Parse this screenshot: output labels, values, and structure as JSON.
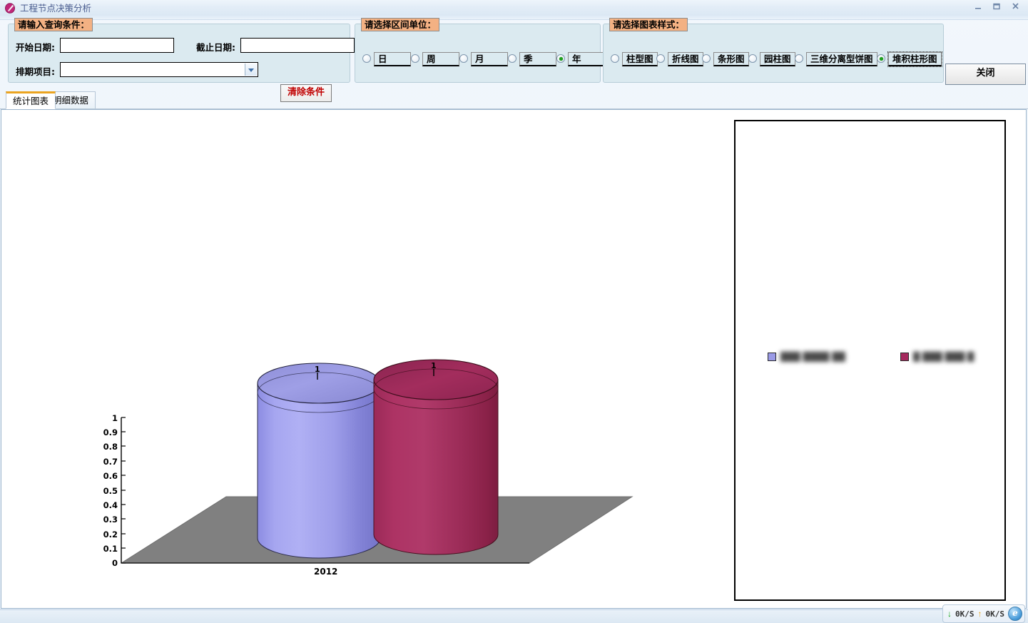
{
  "window": {
    "title": "工程节点决策分析",
    "icon": "access-database-icon",
    "minimize_label": "–",
    "maximize_label": "❐",
    "close_label": "✕"
  },
  "query_group": {
    "legend": "请输入查询条件：",
    "start_date": {
      "label": "开始日期:",
      "value": "",
      "placeholder": ""
    },
    "end_date": {
      "label": "截止日期:",
      "value": "",
      "placeholder": ""
    },
    "project": {
      "label": "排期项目:",
      "value": "",
      "placeholder": "",
      "options": []
    },
    "clear_button": "清除条件"
  },
  "unit_group": {
    "legend": "请选择区间单位：",
    "options": [
      {
        "label": "日",
        "selected": false
      },
      {
        "label": "周",
        "selected": false
      },
      {
        "label": "月",
        "selected": false
      },
      {
        "label": "季",
        "selected": false
      },
      {
        "label": "年",
        "selected": true
      }
    ],
    "selected_value": "年"
  },
  "style_group": {
    "legend": "请选择图表样式：",
    "options": [
      {
        "label": "柱型图",
        "selected": false
      },
      {
        "label": "折线图",
        "selected": false
      },
      {
        "label": "条形图",
        "selected": false
      },
      {
        "label": "园柱图",
        "selected": false
      },
      {
        "label": "三维分离型饼图",
        "selected": false
      },
      {
        "label": "堆积柱形图",
        "selected": true
      }
    ],
    "selected_value": "堆积柱形图"
  },
  "close_button": "关闭",
  "tabs": [
    {
      "label": "统计图表",
      "active": true
    },
    {
      "label": "明细数据",
      "active": false
    }
  ],
  "chart_data": {
    "type": "bar",
    "render_style": "3d-cylinder",
    "title": "",
    "xlabel": "",
    "ylabel": "",
    "categories": [
      "2012"
    ],
    "ylim": [
      0,
      1
    ],
    "ytick_labels": [
      "1",
      "0.9",
      "0.8",
      "0.7",
      "0.6",
      "0.5",
      "0.4",
      "0.3",
      "0.2",
      "0.1",
      "0"
    ],
    "grid": false,
    "legend_position": "right",
    "series": [
      {
        "name": "",
        "name_state": "blurred",
        "color": "#9a9ae6",
        "values": [
          1
        ],
        "data_labels": [
          "1"
        ]
      },
      {
        "name": "",
        "name_state": "blurred",
        "color": "#a52a5e",
        "values": [
          1
        ],
        "data_labels": [
          "1"
        ]
      }
    ],
    "legend_entries": [
      {
        "text": "███ ████ ██",
        "color": "#9a9ae6"
      },
      {
        "text": "█ ███ ███ █",
        "color": "#a52a5e"
      }
    ],
    "floor_color": "#808080"
  },
  "statusbar": {
    "download_arrow": "down-arrow-icon",
    "download_rate": "0K/S",
    "upload_arrow": "up-arrow-icon",
    "upload_rate": "0K/S",
    "browser_icon": "internet-explorer-icon",
    "browser_glyph": "e"
  },
  "colors": {
    "group_bg": "#dbeaf0",
    "group_legend_bg": "#f3b183",
    "tab_active_accent": "#eba420",
    "clear_button_text": "#c00000",
    "series_blue": "#9a9ae6",
    "series_red": "#a52a5e",
    "floor_gray": "#808080"
  }
}
